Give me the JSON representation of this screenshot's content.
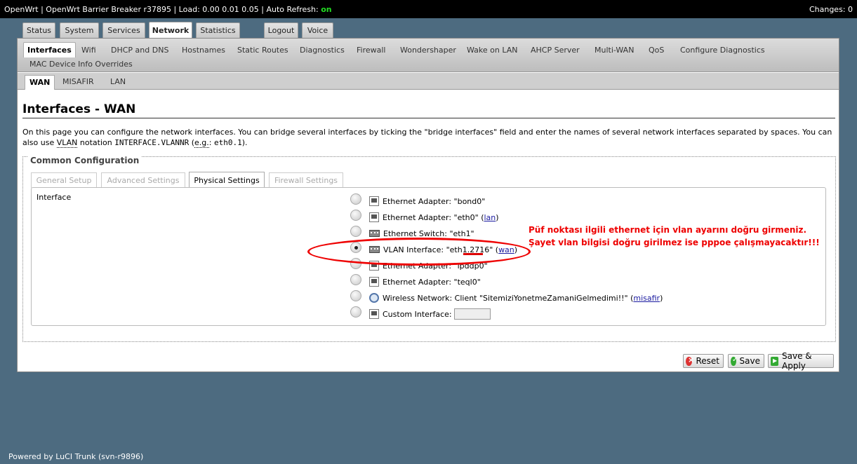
{
  "header": {
    "title": "OpenWrt | OpenWrt Barrier Breaker r37895 | Load: 0.00 0.01 0.05 | Auto Refresh:",
    "auto_refresh_state": "on",
    "changes": "Changes: 0"
  },
  "main_tabs": [
    "Status",
    "System",
    "Services",
    "Network",
    "Statistics",
    "Logout",
    "Voice"
  ],
  "active_main_tab": "Network",
  "network_menu": [
    "Interfaces",
    "Wifi",
    "DHCP and DNS",
    "Hostnames",
    "Static Routes",
    "Diagnostics",
    "Firewall",
    "Wondershaper",
    "Wake on LAN",
    "AHCP Server",
    "Multi-WAN",
    "QoS",
    "Configure Diagnostics",
    "MAC Device Info Overrides"
  ],
  "interface_tabs": [
    "WAN",
    "MISAFIR",
    "LAN"
  ],
  "page": {
    "title": "Interfaces - WAN",
    "desc_1": "On this page you can configure the network interfaces. You can bridge several interfaces by ticking the \"bridge interfaces\" field and enter the names of several network interfaces separated by spaces. You can also use",
    "desc_vlan": "VLAN",
    "desc_2": "notation",
    "desc_code": "INTERFACE.VLANNR",
    "desc_3": "(",
    "desc_eg": "e.g.",
    "desc_4": ":",
    "desc_example": "eth0.1",
    "desc_5": ")."
  },
  "section": {
    "legend": "Common Configuration",
    "tabs": [
      "General Setup",
      "Advanced Settings",
      "Physical Settings",
      "Firewall Settings"
    ],
    "active_tab": "Physical Settings",
    "field_label": "Interface"
  },
  "interfaces": [
    {
      "text": "Ethernet Adapter: \"bond0\"",
      "link": "",
      "icon": "ethernet-icon"
    },
    {
      "text": "Ethernet Adapter: \"eth0\" (",
      "link": "lan",
      "icon": "ethernet-icon"
    },
    {
      "text": "Ethernet Switch: \"eth1\"",
      "link": "",
      "icon": "switch-icon"
    },
    {
      "text": "VLAN Interface: \"eth1.2716\" (",
      "link": "wan",
      "icon": "switch-icon",
      "checked": true
    },
    {
      "text": "Ethernet Adapter: \"ipddp0\"",
      "link": "",
      "icon": "ethernet-icon"
    },
    {
      "text": "Ethernet Adapter: \"teql0\"",
      "link": "",
      "icon": "ethernet-icon"
    },
    {
      "text": "Wireless Network: Client \"SitemiziYonetmeZamaniGelmedimi!!\" (",
      "link": "misafir",
      "icon": "wifi-icon"
    },
    {
      "text": "Custom Interface:",
      "link": "",
      "icon": "ethernet-icon"
    }
  ],
  "annotation": {
    "line1": "Püf noktası ilgili ethernet için vlan ayarını doğru girmeniz.",
    "line2": "Şayet vlan bilgisi doğru girilmez ise pppoe çalışmayacaktır!!!"
  },
  "buttons": {
    "reset": "Reset",
    "save": "Save",
    "save_apply": "Save & Apply"
  },
  "footer": "Powered by LuCI Trunk (svn-r9896)"
}
